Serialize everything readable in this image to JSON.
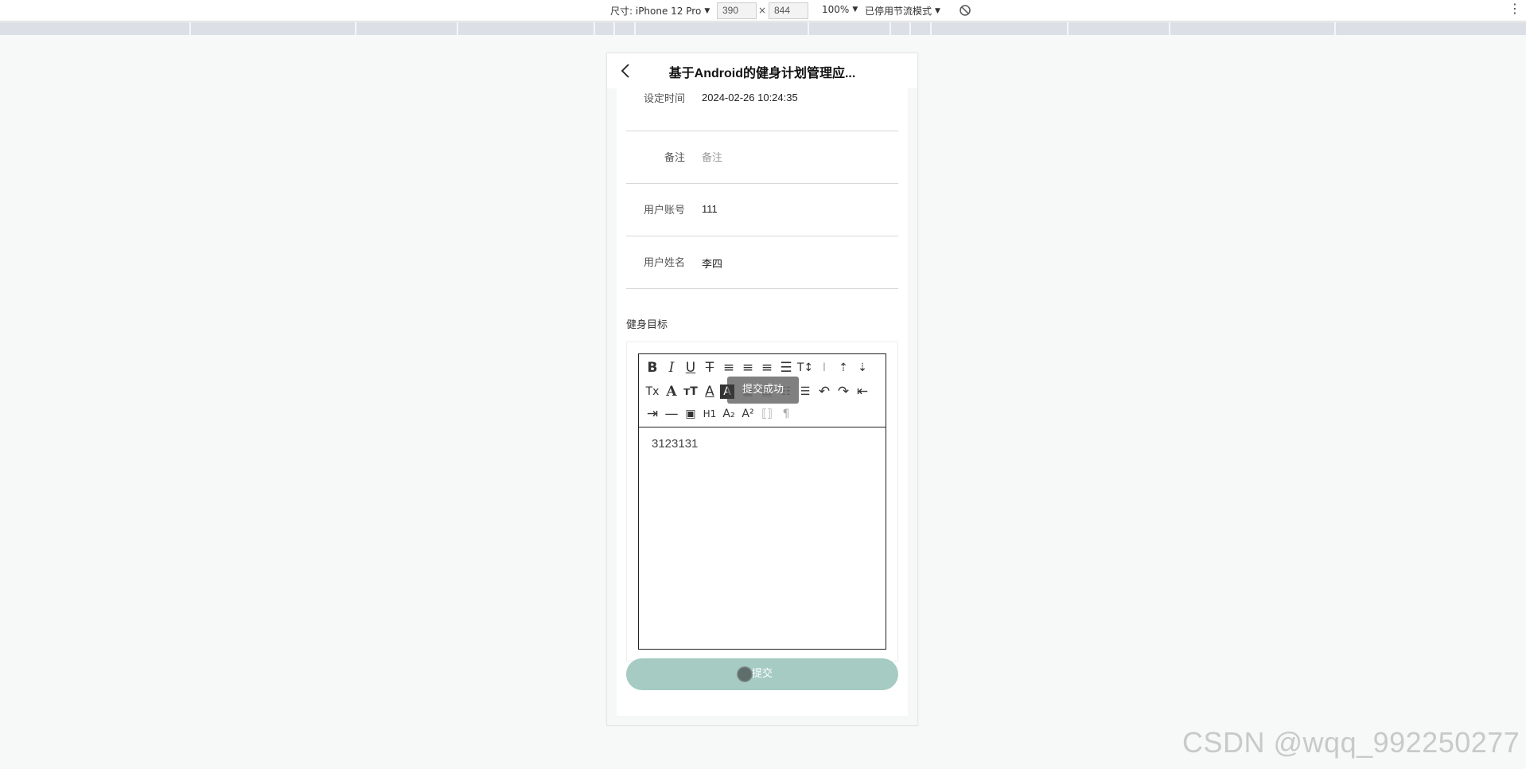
{
  "devtools": {
    "device_label": "尺寸: iPhone 12 Pro",
    "width": "390",
    "height": "844",
    "times": "×",
    "zoom": "100%",
    "throttle": "已停用节流模式",
    "more": "⋮"
  },
  "nav": {
    "title": "基于Android的健身计划管理应..."
  },
  "form": {
    "rows": [
      {
        "label": "设定时间",
        "value": "2024-02-26 10:24:35"
      },
      {
        "label": "备注",
        "value": "",
        "placeholder": "备注"
      },
      {
        "label": "用户账号",
        "value": "111"
      },
      {
        "label": "用户姓名",
        "value": "李四"
      }
    ],
    "goal_label": "健身目标",
    "editor_content": "3123131",
    "submit_label": "提交"
  },
  "toast": "提交成功",
  "watermark": "CSDN @wqq_992250277",
  "toolbar_icons": [
    "bold-icon",
    "italic-icon",
    "underline-icon",
    "strikethrough-icon",
    "align-left-icon",
    "align-center-icon",
    "align-right-icon",
    "align-justify-icon",
    "font-size-icon",
    "line-height-icon",
    "paragraph-space-before-icon",
    "paragraph-space-after-icon",
    "clear-format-icon",
    "font-family-icon",
    "text-size-icon",
    "text-color-icon",
    "background-color-icon",
    "date-icon",
    "clipboard-icon",
    "ordered-list-icon",
    "unordered-list-icon",
    "undo-icon",
    "redo-icon",
    "outdent-icon",
    "indent-icon",
    "horizontal-rule-icon",
    "image-icon",
    "heading-icon",
    "subscript-icon",
    "superscript-icon",
    "code-icon",
    "pilcrow-icon"
  ],
  "colors": {
    "submit_bg": "#a5cbc2",
    "page_bg": "#f7f8f8"
  }
}
